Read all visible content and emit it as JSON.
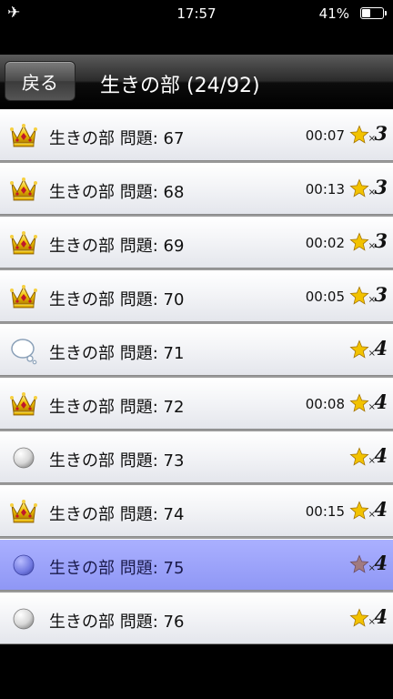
{
  "status": {
    "time": "17:57",
    "battery": "41%",
    "battery_level": 0.41,
    "airplane_icon": "airplane-icon"
  },
  "navbar": {
    "back_label": "戻る",
    "title": "生きの部 (24/92)"
  },
  "rows": [
    {
      "icon": "crown",
      "label": "生きの部 問題: 67",
      "time": "00:07",
      "count": "3",
      "selected": false
    },
    {
      "icon": "crown",
      "label": "生きの部 問題: 68",
      "time": "00:13",
      "count": "3",
      "selected": false
    },
    {
      "icon": "crown",
      "label": "生きの部 問題: 69",
      "time": "00:02",
      "count": "3",
      "selected": false
    },
    {
      "icon": "crown",
      "label": "生きの部 問題: 70",
      "time": "00:05",
      "count": "3",
      "selected": false
    },
    {
      "icon": "thought",
      "label": "生きの部 問題: 71",
      "time": "",
      "count": "4",
      "selected": false
    },
    {
      "icon": "crown",
      "label": "生きの部 問題: 72",
      "time": "00:08",
      "count": "4",
      "selected": false
    },
    {
      "icon": "circle",
      "label": "生きの部 問題: 73",
      "time": "",
      "count": "4",
      "selected": false
    },
    {
      "icon": "crown",
      "label": "生きの部 問題: 74",
      "time": "00:15",
      "count": "4",
      "selected": false
    },
    {
      "icon": "circle",
      "label": "生きの部 問題: 75",
      "time": "",
      "count": "4",
      "selected": true
    },
    {
      "icon": "circle",
      "label": "生きの部 問題: 76",
      "time": "",
      "count": "4",
      "selected": false
    }
  ],
  "times_symbol": "×",
  "colors": {
    "selected_row": "#9aa1fa",
    "star": "#f2c200",
    "crown_gold": "#e8b400",
    "gem": "#c0182a"
  }
}
